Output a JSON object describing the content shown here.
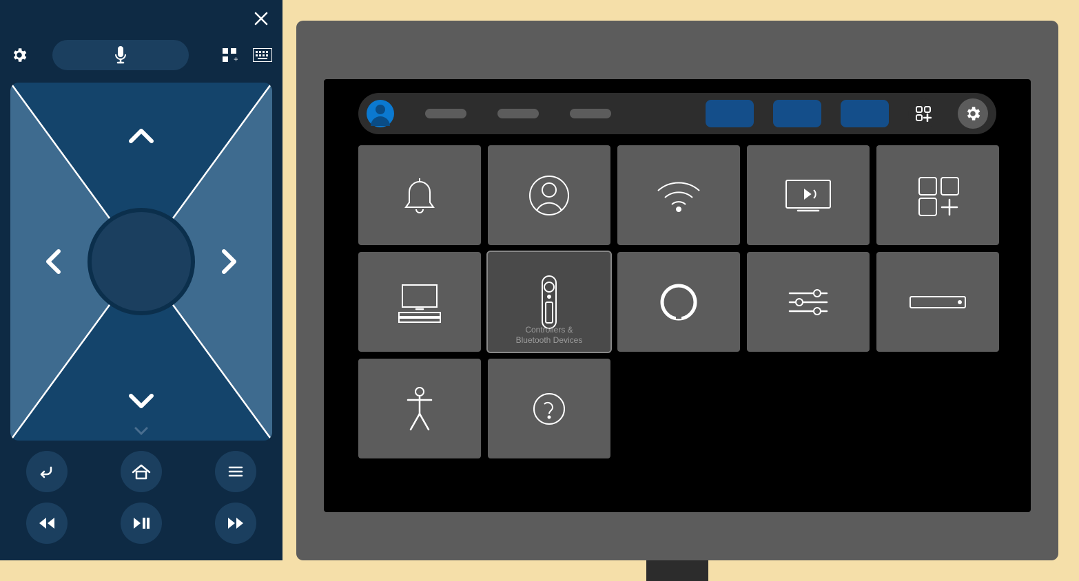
{
  "remote": {
    "mic_label": "",
    "buttons": {
      "back": "",
      "home": "",
      "menu": "",
      "rew": "",
      "playpause": "",
      "ff": ""
    }
  },
  "tv": {
    "tiles": [
      {
        "name": "notifications-tile",
        "label": ""
      },
      {
        "name": "account-tile",
        "label": ""
      },
      {
        "name": "network-tile",
        "label": ""
      },
      {
        "name": "display-sound-tile",
        "label": ""
      },
      {
        "name": "applications-tile",
        "label": ""
      },
      {
        "name": "equipment-tile",
        "label": ""
      },
      {
        "name": "controllers-tile",
        "label": "Controllers &\nBluetooth Devices",
        "selected": true
      },
      {
        "name": "alexa-tile",
        "label": ""
      },
      {
        "name": "preferences-tile",
        "label": ""
      },
      {
        "name": "my-fire-tv-tile",
        "label": ""
      },
      {
        "name": "accessibility-tile",
        "label": ""
      },
      {
        "name": "help-tile",
        "label": ""
      }
    ]
  }
}
